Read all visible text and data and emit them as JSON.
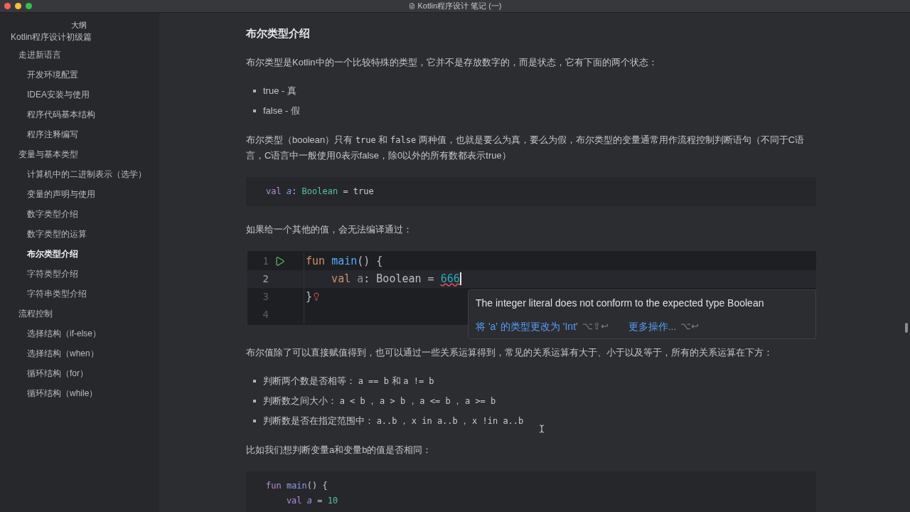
{
  "window": {
    "title": "Kotlin程序设计 笔记 (一)"
  },
  "sidebar": {
    "title": "大纲",
    "items": [
      {
        "label": "Kotlin程序设计初级篇",
        "selected": false,
        "children": [
          {
            "label": "走进新语言",
            "selected": false,
            "children": [
              {
                "label": "开发环境配置",
                "selected": false
              },
              {
                "label": "IDEA安装与使用",
                "selected": false
              },
              {
                "label": "程序代码基本结构",
                "selected": false
              },
              {
                "label": "程序注释编写",
                "selected": false
              }
            ]
          },
          {
            "label": "变量与基本类型",
            "selected": false,
            "children": [
              {
                "label": "计算机中的二进制表示（选学）",
                "selected": false
              },
              {
                "label": "变量的声明与使用",
                "selected": false
              },
              {
                "label": "数字类型介绍",
                "selected": false
              },
              {
                "label": "数字类型的运算",
                "selected": false
              },
              {
                "label": "布尔类型介绍",
                "selected": true
              },
              {
                "label": "字符类型介绍",
                "selected": false
              },
              {
                "label": "字符串类型介绍",
                "selected": false
              }
            ]
          },
          {
            "label": "流程控制",
            "selected": false,
            "children": [
              {
                "label": "选择结构（if-else）",
                "selected": false
              },
              {
                "label": "选择结构（when）",
                "selected": false
              },
              {
                "label": "循环结构（for）",
                "selected": false
              },
              {
                "label": "循环结构（while）",
                "selected": false
              }
            ]
          }
        ]
      }
    ]
  },
  "content": [
    {
      "kind": "heading",
      "text": "布尔类型介绍"
    },
    {
      "kind": "paragraph",
      "parts": [
        {
          "text": "布尔类型是Kotlin中的一个比较特殊的类型，它并不是存放数字的，而是状态，它有下面的两个状态：",
          "code": false
        }
      ]
    },
    {
      "kind": "list",
      "items": [
        [
          {
            "text": "true - 真",
            "code": false
          }
        ],
        [
          {
            "text": "false - 假",
            "code": false
          }
        ]
      ]
    },
    {
      "kind": "paragraph",
      "parts": [
        {
          "text": "布尔类型（boolean）只有 ",
          "code": false
        },
        {
          "text": "true",
          "code": true
        },
        {
          "text": " 和 ",
          "code": false
        },
        {
          "text": "false",
          "code": true
        },
        {
          "text": " 两种值，也就是要么为真，要么为假，布尔类型的变量通常用作流程控制判断语句（不同于C语言，C语言中一般使用0表示false，除0以外的所有数都表示true）",
          "code": false
        }
      ]
    },
    {
      "kind": "code",
      "lines": [
        [
          {
            "text": "val ",
            "kind": "keyword"
          },
          {
            "text": "a",
            "kind": "variable"
          },
          {
            "text": ": ",
            "kind": "plain"
          },
          {
            "text": "Boolean",
            "kind": "type"
          },
          {
            "text": " = true",
            "kind": "plain"
          }
        ]
      ]
    },
    {
      "kind": "paragraph",
      "parts": [
        {
          "text": "如果给一个其他的值，会无法编译通过：",
          "code": false
        }
      ]
    },
    {
      "kind": "ide",
      "lines": [
        {
          "number": "1",
          "run": true,
          "current": false,
          "bulb": false,
          "tokens": [
            {
              "text": "fun ",
              "kind": "ide_keyword",
              "error": false
            },
            {
              "text": "main",
              "kind": "ide_function",
              "error": false
            },
            {
              "text": "() {",
              "kind": "ide_plain",
              "error": false
            }
          ]
        },
        {
          "number": "2",
          "run": false,
          "current": true,
          "bulb": false,
          "tokens": [
            {
              "text": "    val ",
              "kind": "ide_keyword",
              "error": false
            },
            {
              "text": "a",
              "kind": "ide_unused",
              "error": false
            },
            {
              "text": ": Boolean = ",
              "kind": "ide_plain",
              "error": false
            },
            {
              "text": "666",
              "kind": "ide_number",
              "error": true
            }
          ]
        },
        {
          "number": "3",
          "run": false,
          "current": false,
          "bulb": true,
          "tokens": [
            {
              "text": "}",
              "kind": "ide_plain",
              "error": false
            }
          ]
        },
        {
          "number": "4",
          "run": false,
          "current": false,
          "bulb": false
        }
      ],
      "tooltip": {
        "message": "The integer literal does not conform to the expected type Boolean",
        "actions": [
          {
            "label": "将 'a' 的类型更改为 'Int'",
            "shortcut": "⌥⇧↩"
          },
          {
            "label": "更多操作...",
            "shortcut": "⌥↩"
          }
        ]
      }
    },
    {
      "kind": "paragraph",
      "parts": [
        {
          "text": "布尔值除了可以直接赋值得到，也可以通过一些关系运算得到，常见的关系运算有大于、小于以及等于，所有的关系运算在下方：",
          "code": false
        }
      ]
    },
    {
      "kind": "list",
      "items": [
        [
          {
            "text": "判断两个数是否相等： ",
            "code": false
          },
          {
            "text": "a == b",
            "code": true
          },
          {
            "text": " 和 ",
            "code": false
          },
          {
            "text": "a != b",
            "code": true
          }
        ],
        [
          {
            "text": "判断数之间大小： ",
            "code": false
          },
          {
            "text": "a < b",
            "code": true
          },
          {
            "text": " ， ",
            "code": false
          },
          {
            "text": "a > b",
            "code": true
          },
          {
            "text": " ， ",
            "code": false
          },
          {
            "text": "a <= b",
            "code": true
          },
          {
            "text": " ， ",
            "code": false
          },
          {
            "text": "a >= b",
            "code": true
          }
        ],
        [
          {
            "text": "判断数是否在指定范围中： ",
            "code": false
          },
          {
            "text": "a..b",
            "code": true
          },
          {
            "text": " ， ",
            "code": false
          },
          {
            "text": "x in a..b",
            "code": true
          },
          {
            "text": " ， ",
            "code": false
          },
          {
            "text": "x !in a..b",
            "code": true
          }
        ]
      ]
    },
    {
      "kind": "paragraph",
      "parts": [
        {
          "text": "比如我们想判断变量a和变量b的值是否相同：",
          "code": false
        }
      ]
    },
    {
      "kind": "code",
      "lines": [
        [
          {
            "text": "fun ",
            "kind": "keyword"
          },
          {
            "text": "main",
            "kind": "function"
          },
          {
            "text": "() {",
            "kind": "plain"
          }
        ],
        [
          {
            "text": "    val ",
            "kind": "keyword"
          },
          {
            "text": "a",
            "kind": "variable"
          },
          {
            "text": " = ",
            "kind": "plain"
          },
          {
            "text": "10",
            "kind": "number"
          }
        ]
      ]
    }
  ]
}
